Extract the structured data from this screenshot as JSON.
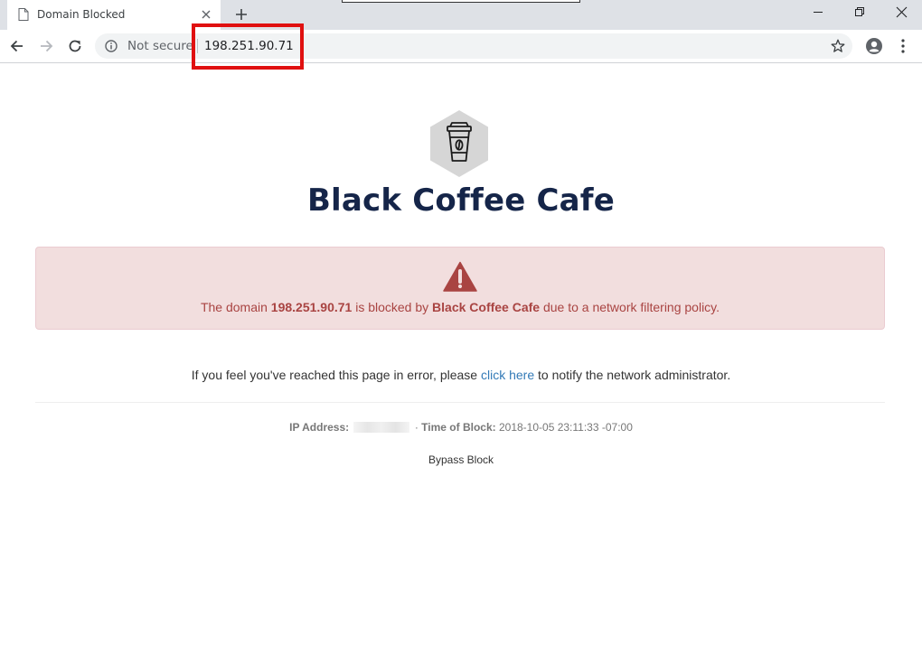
{
  "browser": {
    "tab_title": "Domain Blocked",
    "security_label": "Not secure",
    "url": "198.251.90.71",
    "highlight_color": "#e01010"
  },
  "page": {
    "site_name": "Black Coffee Cafe",
    "alert": {
      "prefix": "The domain ",
      "domain": "198.251.90.71",
      "middle": " is blocked by ",
      "org": "Black Coffee Cafe",
      "suffix": " due to a network filtering policy."
    },
    "error_note": {
      "prefix": "If you feel you've reached this page in error, please ",
      "link": "click here",
      "suffix": " to notify the network administrator."
    },
    "meta": {
      "ip_label": "IP Address:",
      "separator": "·",
      "time_label": "Time of Block:",
      "time_value": "2018-10-05 23:11:33 -07:00"
    },
    "bypass_label": "Bypass Block"
  },
  "colors": {
    "title": "#152549",
    "alert_bg": "#f2dede",
    "alert_text": "#a94442",
    "link": "#337ab7",
    "logo_hex": "#d6d6d6"
  },
  "icons": [
    "page-icon",
    "close-icon",
    "plus-icon",
    "minimize-icon",
    "restore-icon",
    "window-close-icon",
    "back-arrow-icon",
    "forward-arrow-icon",
    "reload-icon",
    "info-icon",
    "star-icon",
    "account-icon",
    "kebab-menu-icon",
    "coffee-cup-icon",
    "warning-icon"
  ]
}
